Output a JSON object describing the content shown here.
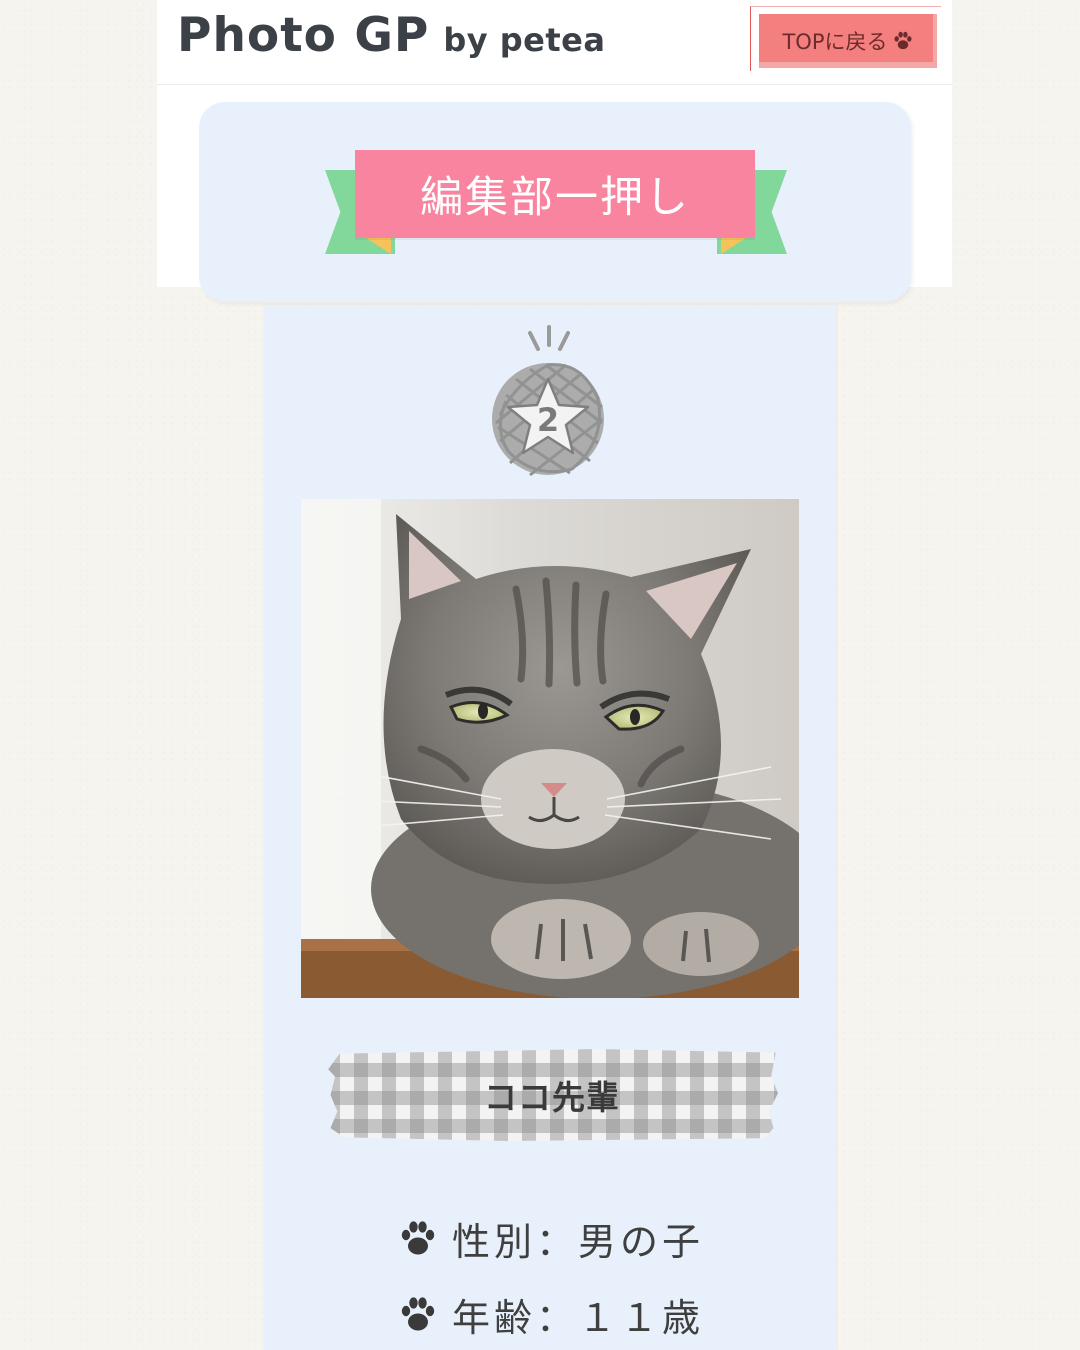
{
  "header": {
    "logo_main": "Photo GP",
    "logo_sub": "by petea",
    "top_button_label": "TOPに戻る"
  },
  "banner": {
    "title": "編集部一押し"
  },
  "entry": {
    "rank": "2",
    "name": "ココ先輩",
    "gender_label": "性別",
    "gender_value": "男の子",
    "age_label": "年齢",
    "age_value": "１１歳",
    "separator": "："
  },
  "colors": {
    "page_bg": "#f6f4ee",
    "card_bg": "#e8f1fb",
    "ribbon_pink": "#f9849f",
    "ribbon_green": "#82d89a",
    "top_button": "#f47f7f",
    "text_dark": "#3b4146"
  },
  "icons": [
    "paw-icon",
    "star-rank-badge"
  ]
}
